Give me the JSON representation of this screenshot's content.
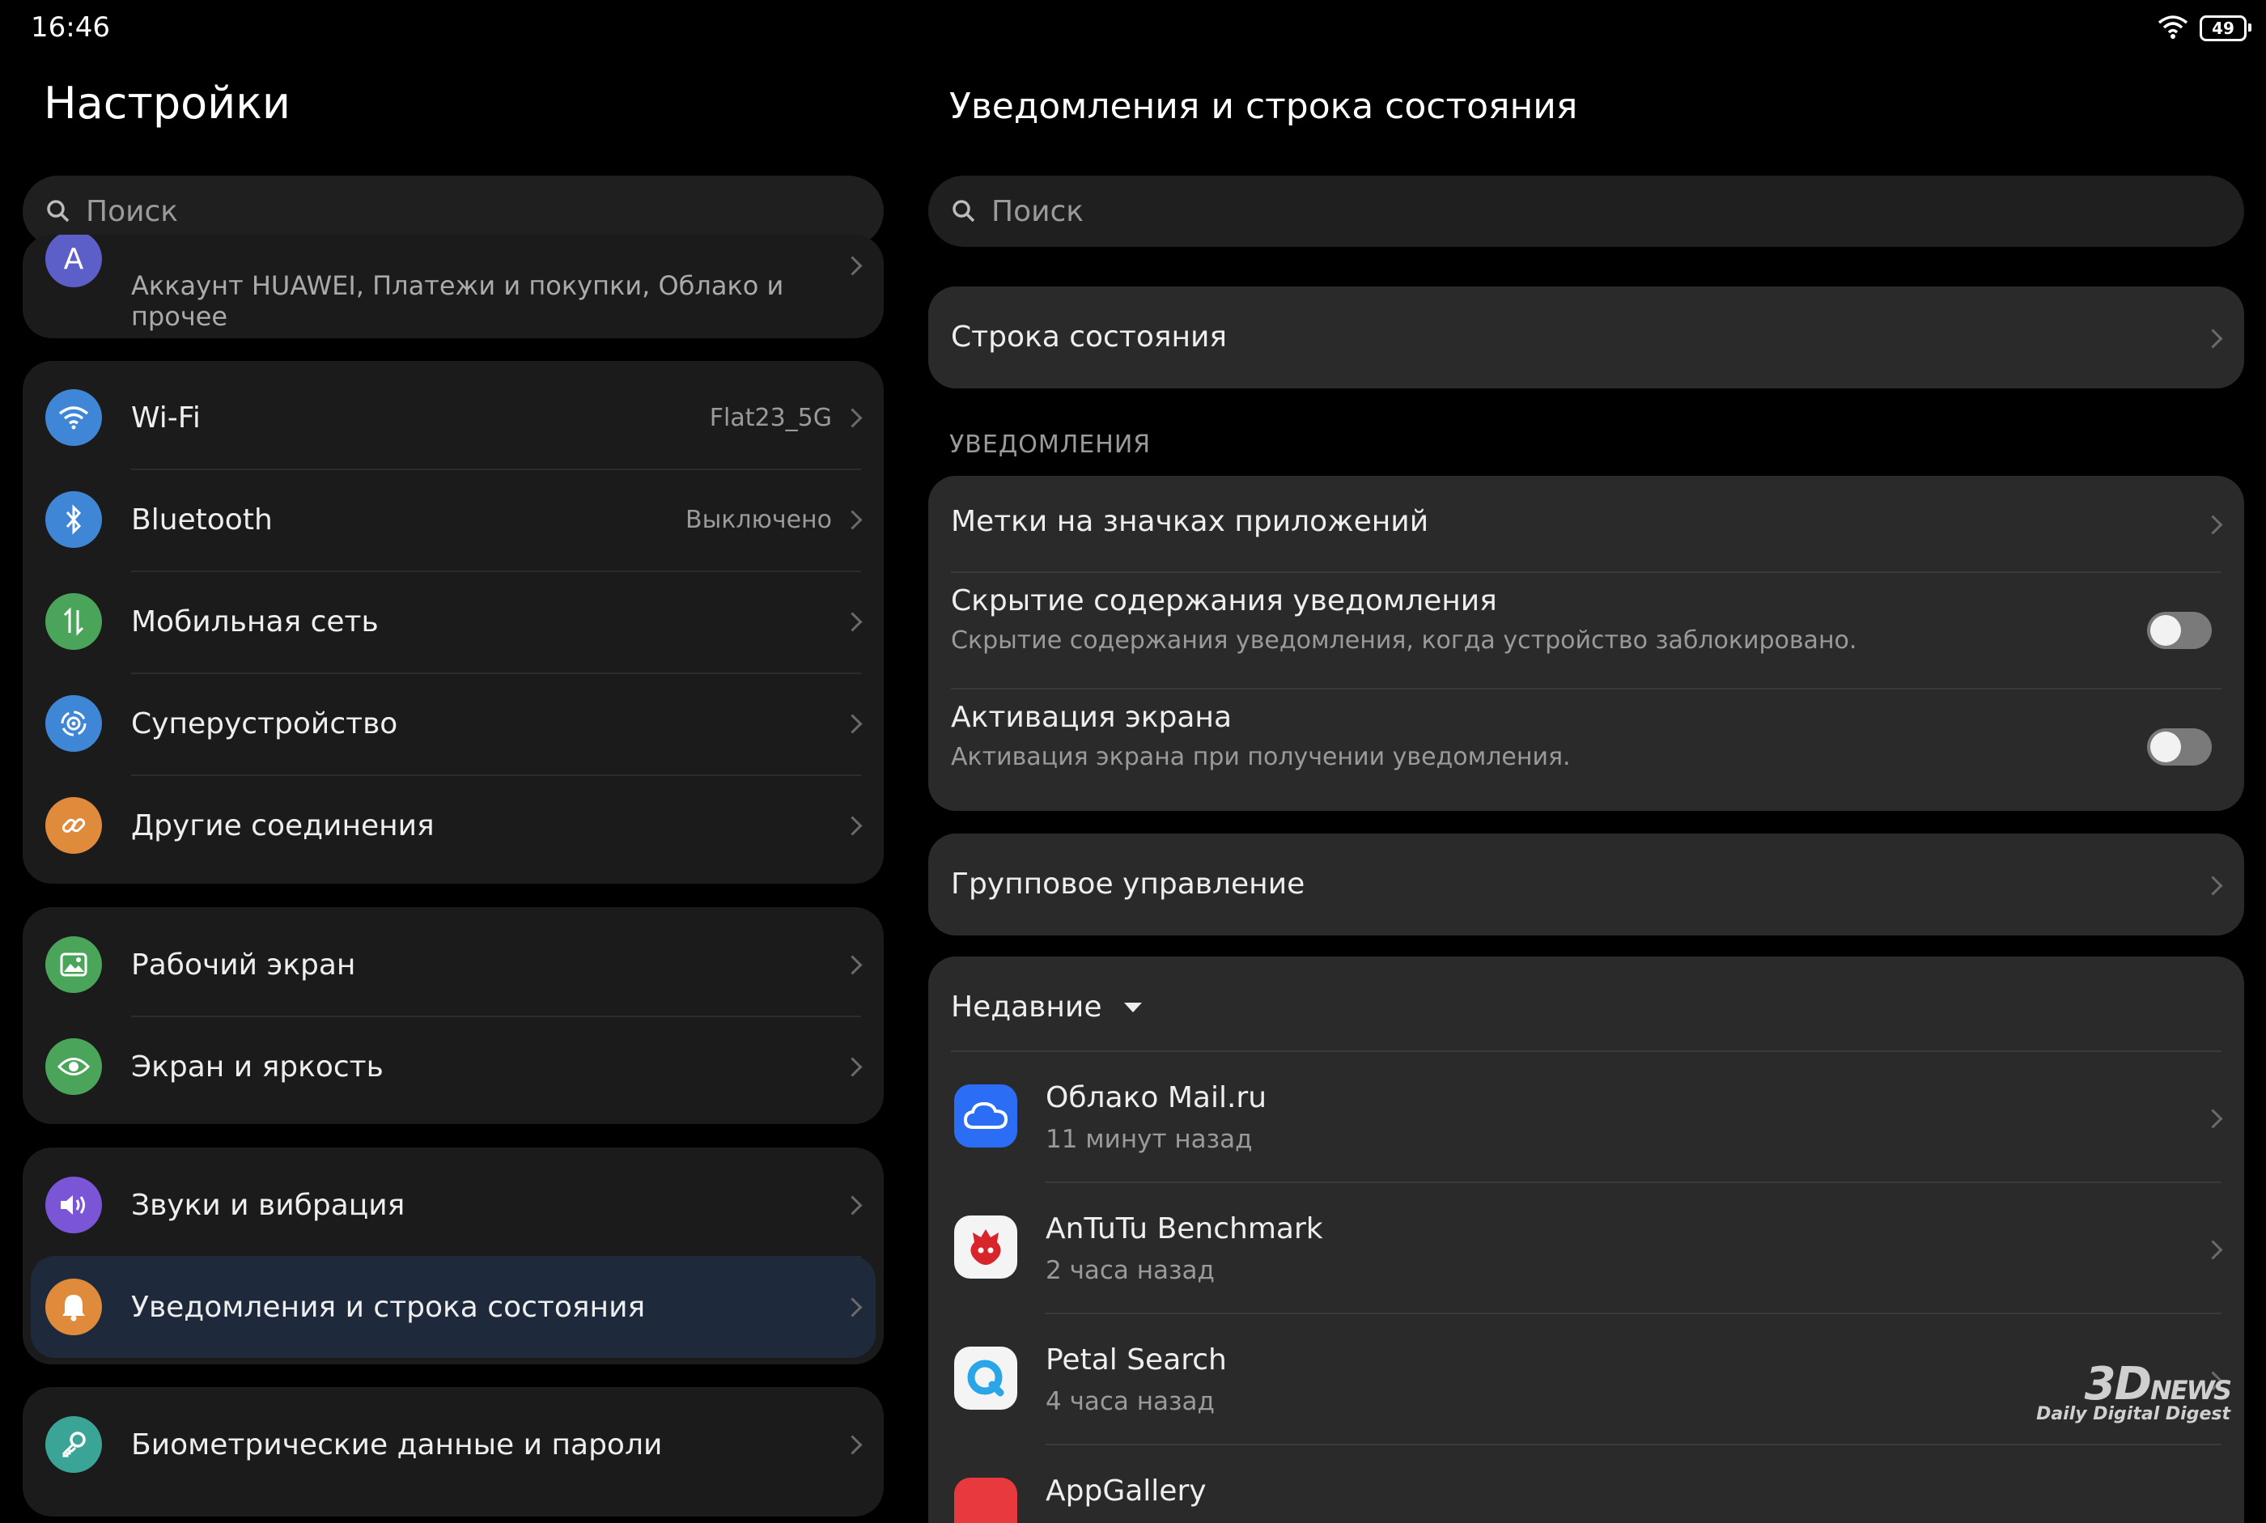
{
  "status_bar": {
    "time": "16:46",
    "battery": "49"
  },
  "left": {
    "title": "Настройки",
    "search_placeholder": "Поиск",
    "account": {
      "subtitle": "Аккаунт HUAWEI, Платежи и покупки, Облако и прочее",
      "avatar_letter": "A"
    },
    "group1": [
      {
        "label": "Wi-Fi",
        "value": "Flat23_5G",
        "icon": "wifi-icon",
        "color": "#3f86d6"
      },
      {
        "label": "Bluetooth",
        "value": "Выключено",
        "icon": "bluetooth-icon",
        "color": "#3f86d6"
      },
      {
        "label": "Мобильная сеть",
        "value": "",
        "icon": "mobile-data-icon",
        "color": "#4aa55a"
      },
      {
        "label": "Суперустройство",
        "value": "",
        "icon": "superdevice-icon",
        "color": "#3f86d6"
      },
      {
        "label": "Другие соединения",
        "value": "",
        "icon": "link-icon",
        "color": "#e08a3c"
      }
    ],
    "group2": [
      {
        "label": "Рабочий экран",
        "icon": "home-screen-icon",
        "color": "#4aa55a"
      },
      {
        "label": "Экран и яркость",
        "icon": "eye-icon",
        "color": "#4aa55a"
      }
    ],
    "group3": [
      {
        "label": "Звуки и вибрация",
        "icon": "sound-icon",
        "color": "#7a55d6"
      },
      {
        "label": "Уведомления и строка состояния",
        "icon": "bell-icon",
        "color": "#e08a3c"
      }
    ],
    "group4": [
      {
        "label": "Биометрические данные и пароли",
        "icon": "key-icon",
        "color": "#3aa597"
      }
    ]
  },
  "right": {
    "title": "Уведомления и строка состояния",
    "search_placeholder": "Поиск",
    "status_bar_item": "Строка состояния",
    "section_notifications": "УВЕДОМЛЕНИЯ",
    "badges_item": "Метки на значках приложений",
    "hide_content": {
      "title": "Скрытие содержания уведомления",
      "subtitle": "Скрытие содержания уведомления, когда устройство заблокировано.",
      "enabled": false
    },
    "wake_screen": {
      "title": "Активация экрана",
      "subtitle": "Активация экрана при получении уведомления.",
      "enabled": false
    },
    "group_management": "Групповое управление",
    "recent": {
      "label": "Недавние",
      "apps": [
        {
          "name": "Облако Mail.ru",
          "time": "11 минут назад",
          "icon": "mail-cloud-icon"
        },
        {
          "name": "AnTuTu Benchmark",
          "time": "2 часа назад",
          "icon": "antutu-icon"
        },
        {
          "name": "Petal Search",
          "time": "4 часа назад",
          "icon": "petal-search-icon"
        },
        {
          "name": "AppGallery",
          "time": "",
          "icon": "appgallery-icon"
        }
      ]
    }
  },
  "watermark": {
    "brand": "3D",
    "brand_suffix": "NEWS",
    "tagline": "Daily Digital Digest"
  }
}
